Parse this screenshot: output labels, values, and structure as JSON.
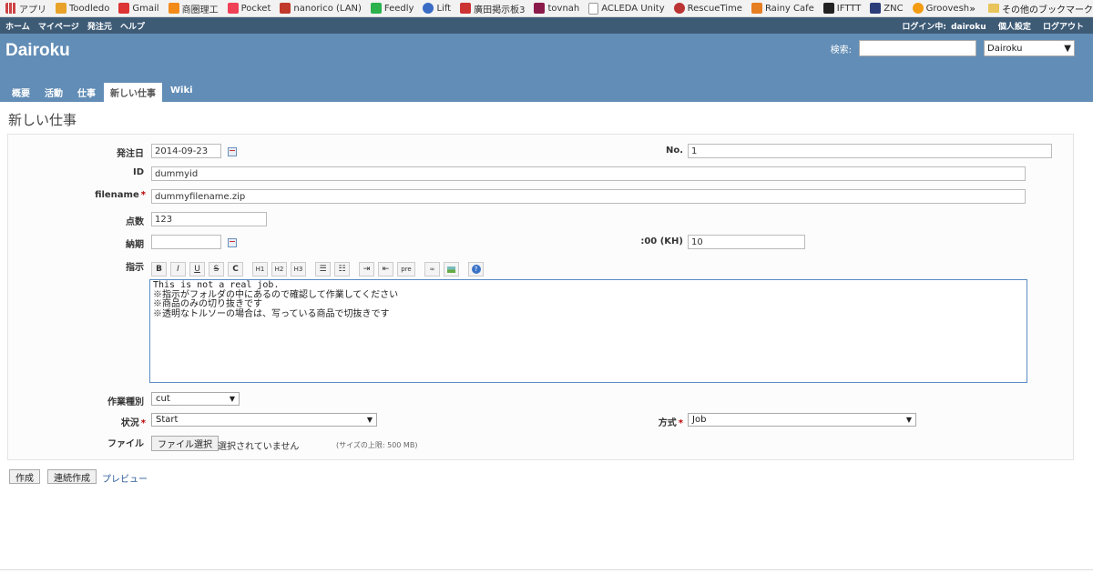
{
  "bookmarks": {
    "items": [
      {
        "label": "アプリ",
        "color": "#c44"
      },
      {
        "label": "Toodledo",
        "color": "#e8a22a"
      },
      {
        "label": "Gmail",
        "color": "#d33"
      },
      {
        "label": "商圏理工",
        "color": "#f28a1a"
      },
      {
        "label": "Pocket",
        "color": "#ef4056"
      },
      {
        "label": "nanorico (LAN)",
        "color": "#c0392b"
      },
      {
        "label": "Feedly",
        "color": "#2bb24c"
      },
      {
        "label": "Lift",
        "color": "#3a6bc4"
      },
      {
        "label": "廣田掲示板3",
        "color": "#c33"
      },
      {
        "label": "tovnah",
        "color": "#8a1a4a"
      },
      {
        "label": "ACLEDA Unity",
        "color": "#bbb"
      },
      {
        "label": "RescueTime",
        "color": "#b33"
      },
      {
        "label": "Rainy Cafe",
        "color": "#e67e22"
      },
      {
        "label": "IFTTT",
        "color": "#222"
      },
      {
        "label": "ZNC",
        "color": "#2c3e7a"
      },
      {
        "label": "Grooveshark",
        "color": "#f39c12"
      }
    ],
    "more": "»",
    "other": "その他のブックマーク"
  },
  "top_menu": {
    "left": [
      "ホーム",
      "マイページ",
      "発注元",
      "ヘルプ"
    ],
    "logged_in_label": "ログイン中:",
    "user": "dairoku",
    "settings": "個人設定",
    "logout": "ログアウト"
  },
  "header": {
    "project": "Dairoku",
    "search_label": "検索:",
    "search_value": "",
    "project_select": "Dairoku",
    "tabs": [
      {
        "label": "概要",
        "active": false
      },
      {
        "label": "活動",
        "active": false
      },
      {
        "label": "仕事",
        "active": false
      },
      {
        "label": "新しい仕事",
        "active": true
      },
      {
        "label": "Wiki",
        "active": false
      }
    ]
  },
  "page_title": "新しい仕事",
  "form": {
    "order_date": {
      "label": "発注日",
      "value": "2014-09-23"
    },
    "no": {
      "label": "No.",
      "value": "1"
    },
    "id": {
      "label": "ID",
      "value": "dummyid"
    },
    "filename": {
      "label": "filename",
      "value": "dummyfilename.zip",
      "required": "*"
    },
    "points": {
      "label": "点数",
      "value": "123"
    },
    "deadline": {
      "label": "納期",
      "value": ""
    },
    "hours": {
      "label": ":00 (KH)",
      "value": "10"
    },
    "instructions": {
      "label": "指示",
      "lines": [
        "This is not a real job.",
        "※指示がフォルダの中にあるので確認して作業してください",
        "※商品のみの切り抜きです",
        "※透明なトルソーの場合は、写っている商品で切抜きです"
      ]
    },
    "toolbar": [
      "B",
      "I",
      "U",
      "S",
      "C",
      "H1",
      "H2",
      "H3",
      "ul",
      "ol",
      "indent",
      "outdent",
      "pre",
      "link",
      "image",
      "help"
    ],
    "work_type": {
      "label": "作業種別",
      "value": "cut"
    },
    "status": {
      "label": "状況",
      "value": "Start",
      "required": "*"
    },
    "method": {
      "label": "方式",
      "value": "Job",
      "required": "*"
    },
    "file": {
      "label": "ファイル",
      "button": "ファイル選択",
      "none": "選択されていません",
      "limit": "(サイズの上限: 500 MB)"
    }
  },
  "actions": {
    "create": "作成",
    "create_continue": "連続作成",
    "preview": "プレビュー"
  }
}
